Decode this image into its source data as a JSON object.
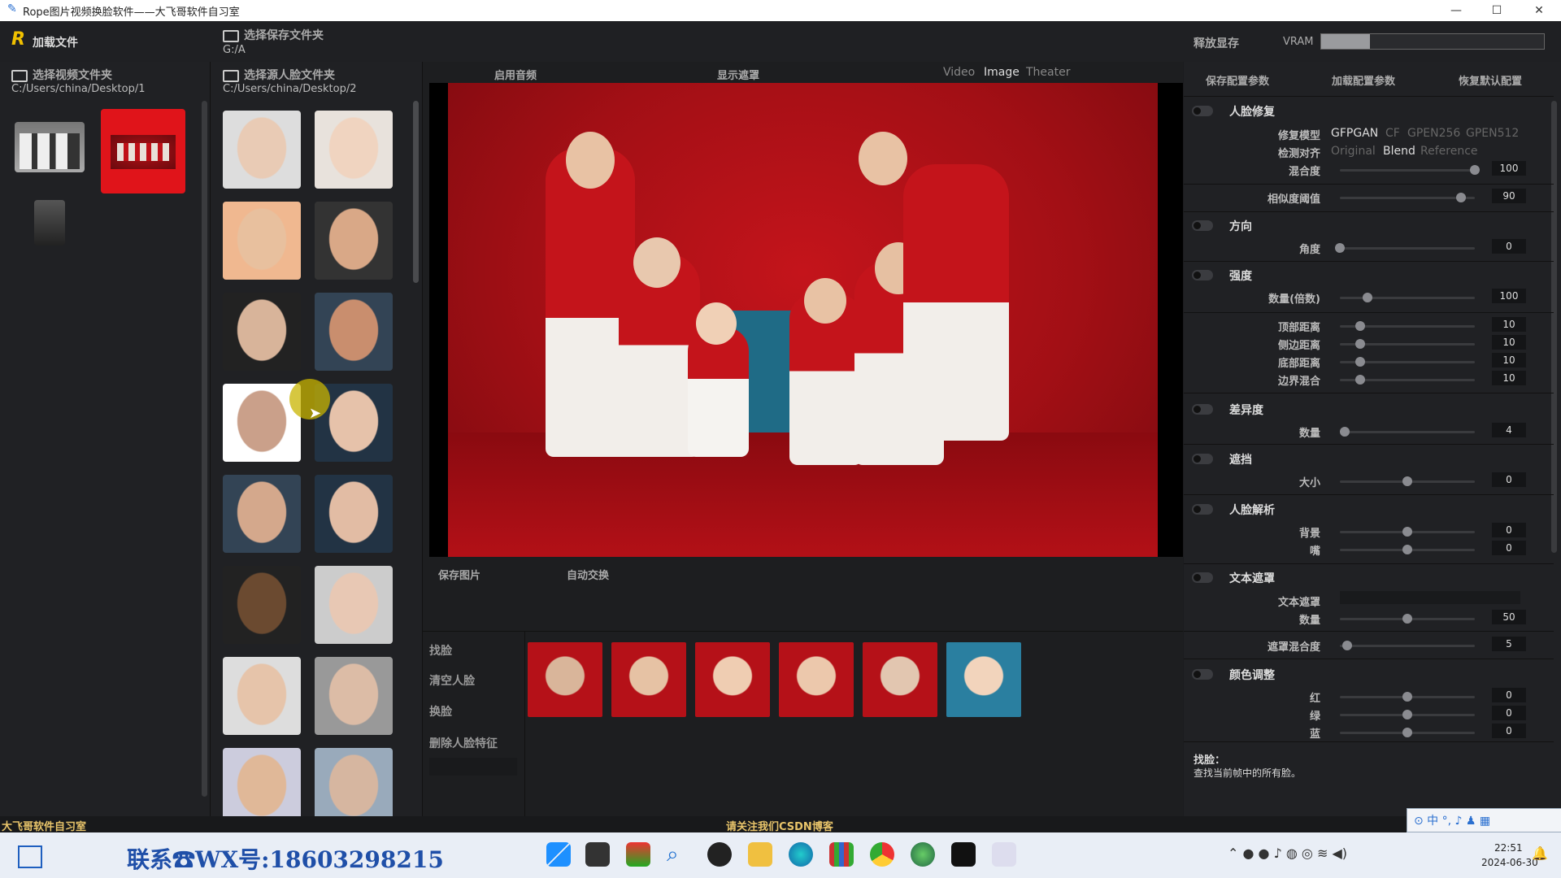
{
  "window": {
    "title": "Rope图片视频换脸软件——大飞哥软件自习室"
  },
  "header": {
    "load_files": "加载文件",
    "save_folder_label": "选择保存文件夹",
    "save_folder_path": "G:/A",
    "release_vram": "释放显存",
    "vram_label": "VRAM",
    "vram_fill": 0.22
  },
  "left": {
    "video_folder_label": "选择视频文件夹",
    "video_folder_path": "C:/Users/china/Desktop/1"
  },
  "source": {
    "face_folder_label": "选择源人脸文件夹",
    "face_folder_path": "C:/Users/china/Desktop/2"
  },
  "center": {
    "enable_audio": "启用音频",
    "show_mask": "显示遮罩",
    "tabs": [
      "Video",
      "Image",
      "Theater"
    ],
    "active_tab": "Image",
    "save_image": "保存图片",
    "auto_swap": "自动交换",
    "actions": [
      "找脸",
      "清空人脸",
      "换脸",
      "删除人脸特征"
    ]
  },
  "right": {
    "top_buttons": [
      "保存配置参数",
      "加载配置参数",
      "恢复默认配置"
    ],
    "face_restore": {
      "title": "人脸修复",
      "model_label": "修复模型",
      "models": [
        "GFPGAN",
        "CF",
        "GPEN256",
        "GPEN512"
      ],
      "selected_model": "GFPGAN",
      "align_label": "检测对齐",
      "aligns": [
        "Original",
        "Blend",
        "Reference"
      ],
      "selected_align": "Blend",
      "blend_label": "混合度",
      "blend_value": "100"
    },
    "similarity": {
      "label": "相似度阈值",
      "value": "90"
    },
    "orientation": {
      "title": "方向",
      "angle_label": "角度",
      "angle_value": "0"
    },
    "strength": {
      "title": "强度",
      "amount_label": "数量(倍数)",
      "amount_value": "100"
    },
    "borders": [
      {
        "label": "顶部距离",
        "value": "10"
      },
      {
        "label": "侧边距离",
        "value": "10"
      },
      {
        "label": "底部距离",
        "value": "10"
      },
      {
        "label": "边界混合",
        "value": "10"
      }
    ],
    "diff": {
      "title": "差异度",
      "amount_label": "数量",
      "value": "4"
    },
    "occluder": {
      "title": "遮挡",
      "size_label": "大小",
      "value": "0"
    },
    "face_parse": {
      "title": "人脸解析",
      "bg_label": "背景",
      "bg_value": "0",
      "mouth_label": "嘴",
      "mouth_value": "0"
    },
    "text_mask": {
      "title": "文本遮罩",
      "text_label": "文本遮罩",
      "amount_label": "数量",
      "amount_value": "50"
    },
    "mask_blend": {
      "label": "遮罩混合度",
      "value": "5"
    },
    "color": {
      "title": "颜色调整",
      "red_label": "红",
      "red": "0",
      "green_label": "绿",
      "green": "0",
      "blue_label": "蓝",
      "blue": "0"
    },
    "hint_title": "找脸：",
    "hint_text": "查找当前帧中的所有脸。"
  },
  "status": {
    "left": "大飞哥软件自习室",
    "center": "请关注我们CSDN博客"
  },
  "taskbar": {
    "contact": "联系☎WX号:18603298215",
    "time": "22:51",
    "date": "2024-06-30"
  },
  "colors": {
    "accent_red": "#e0141a",
    "panel_bg": "#202124",
    "status_yellow": "#e8c46a"
  }
}
